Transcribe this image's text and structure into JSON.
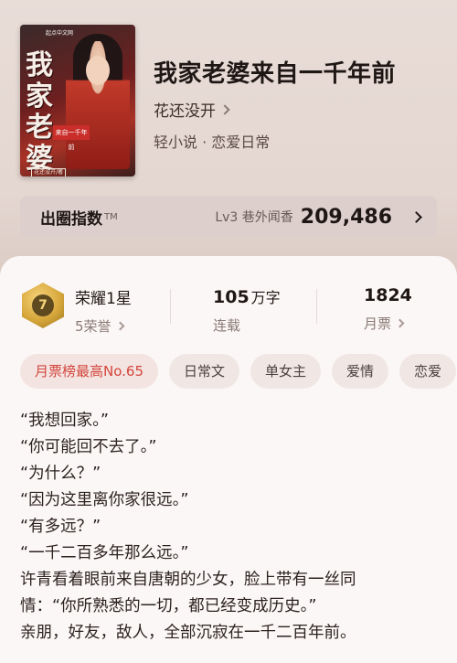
{
  "book": {
    "title": "我家老婆来自一千年前",
    "author": "花还没开",
    "genre": "轻小说 · 恋爱日常"
  },
  "cover": {
    "calligraphy": "我家老婆",
    "tagline": "来自一千年前",
    "author_stamp": "花还没开/著",
    "brand": "起点中文网"
  },
  "index_bar": {
    "label": "出圈指数",
    "tm": "TM",
    "level": "Lv3 巷外闻香",
    "score": "209,486"
  },
  "stats": {
    "honor_title": "荣耀1星",
    "honor_sub": "5荣誉",
    "badge_num": "7",
    "words_value": "105",
    "words_unit": "万字",
    "words_sub": "连载",
    "tickets_value": "1824",
    "tickets_sub": "月票"
  },
  "tags": [
    "月票榜最高No.65",
    "日常文",
    "单女主",
    "爱情",
    "恋爱"
  ],
  "excerpt": [
    "“我想回家。”",
    "“你可能回不去了。”",
    "“为什么？”",
    "“因为这里离你家很远。”",
    "“有多远？”",
    "“一千二百多年那么远。”",
    "许青看着眼前来自唐朝的少女，脸上带有一丝同",
    "情：“你所熟悉的一切，都已经变成历史。”",
    "亲朋，好友，敌人，全部沉寂在一千二百年前。"
  ]
}
